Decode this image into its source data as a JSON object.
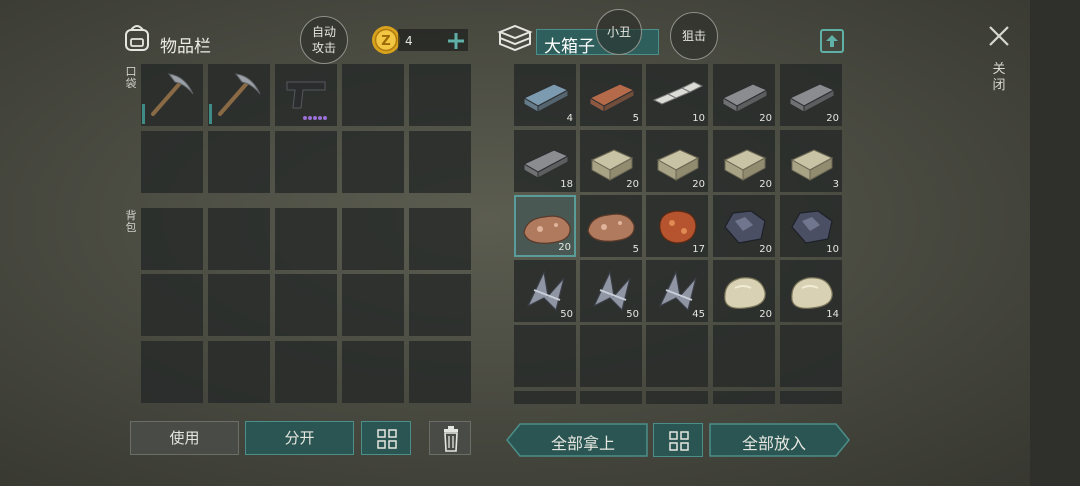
{
  "inventory": {
    "title": "物品栏",
    "auto_attack": [
      "自动",
      "攻击"
    ],
    "coin_count": "4",
    "pocket_label": "口袋",
    "backpack_label": "背包",
    "pocket_items": [
      {
        "icon": "pickaxe-icon"
      },
      {
        "icon": "pickaxe-icon"
      },
      {
        "icon": "pistol-icon"
      }
    ],
    "buttons": {
      "use": "使用",
      "split": "分开"
    }
  },
  "container": {
    "title": "大箱子",
    "clown_label": "小丑",
    "sniper_label": "狙击",
    "items": [
      {
        "icon": "iron-ingot-icon",
        "qty": "4",
        "color": "#7d9bb0"
      },
      {
        "icon": "copper-ingot-icon",
        "qty": "5",
        "color": "#b56a4a"
      },
      {
        "icon": "silver-bars-icon",
        "qty": "10",
        "color": "#dcdcd6"
      },
      {
        "icon": "steel-ingot-icon",
        "qty": "20",
        "color": "#8a8c90"
      },
      {
        "icon": "steel-ingot-icon",
        "qty": "20",
        "color": "#8a8c90"
      },
      {
        "icon": "steel-ingot-icon",
        "qty": "18",
        "color": "#8a8c90"
      },
      {
        "icon": "stone-block-icon",
        "qty": "20",
        "color": "#c9c3a6"
      },
      {
        "icon": "stone-block-icon",
        "qty": "20",
        "color": "#c9c3a6"
      },
      {
        "icon": "stone-block-icon",
        "qty": "20",
        "color": "#c9c3a6"
      },
      {
        "icon": "stone-block-icon",
        "qty": "3",
        "color": "#c9c3a6"
      },
      {
        "icon": "iron-ore-icon",
        "qty": "20",
        "color": "#b07a5e"
      },
      {
        "icon": "iron-ore-icon",
        "qty": "5",
        "color": "#b07a5e"
      },
      {
        "icon": "copper-ore-icon",
        "qty": "17",
        "color": "#b5542e"
      },
      {
        "icon": "coal-icon",
        "qty": "20",
        "color": "#4a4f63"
      },
      {
        "icon": "coal-icon",
        "qty": "10",
        "color": "#4a4f63"
      },
      {
        "icon": "metal-scrap-icon",
        "qty": "50",
        "color": "#8f95a3"
      },
      {
        "icon": "metal-scrap-icon",
        "qty": "50",
        "color": "#8f95a3"
      },
      {
        "icon": "metal-scrap-icon",
        "qty": "45",
        "color": "#8f95a3"
      },
      {
        "icon": "stone-icon",
        "qty": "20",
        "color": "#d8d1b3"
      },
      {
        "icon": "stone-icon",
        "qty": "14",
        "color": "#d8d1b3"
      }
    ],
    "buttons": {
      "take_all": "全部拿上",
      "put_all": "全部放入"
    }
  },
  "close_label": "关闭",
  "colors": {
    "accent": "#2a5552",
    "accent_border": "#4c8e89",
    "coin": "#d9a21c"
  }
}
